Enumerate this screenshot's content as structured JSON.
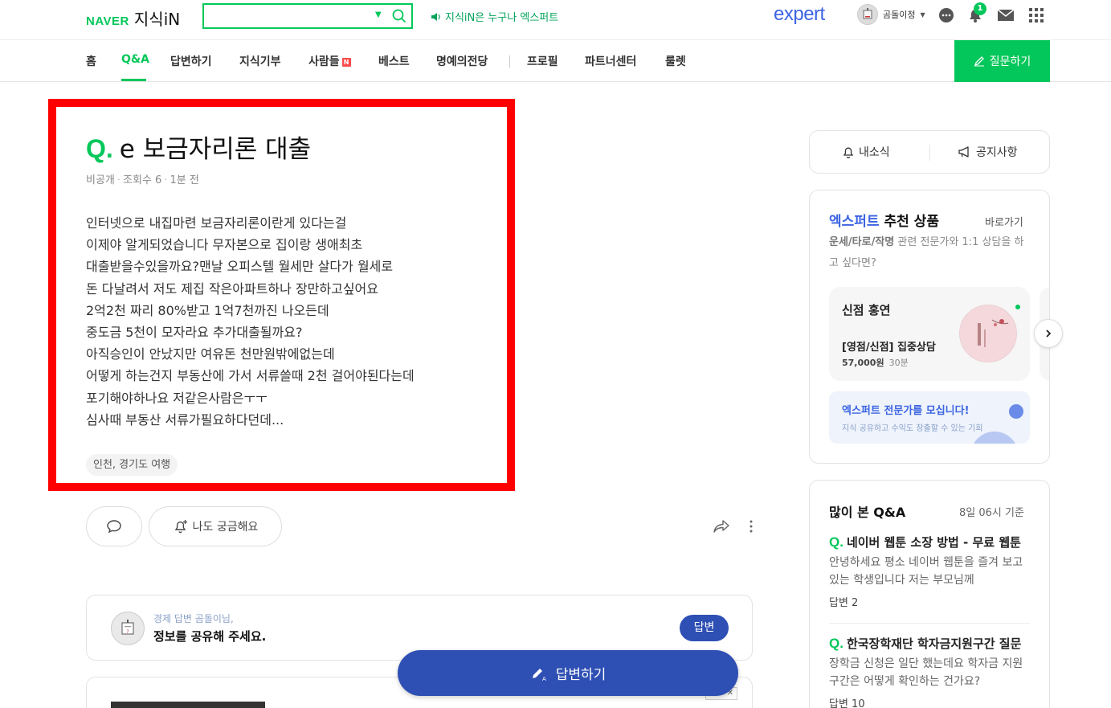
{
  "header": {
    "brand": "NAVER",
    "service": "지식iN",
    "search_placeholder": "",
    "notice": "지식iN은 누구나 엑스퍼트",
    "expert_logo": "expert",
    "user_name": "곰돌이정",
    "notification_count": "1"
  },
  "nav": {
    "items": [
      "홈",
      "Q&A",
      "답변하기",
      "지식기부",
      "사람들",
      "베스트",
      "명예의전당",
      "프로필",
      "파트너센터",
      "룰렛"
    ],
    "n_badge": "N",
    "ask_button": "질문하기"
  },
  "question": {
    "q_mark": "Q.",
    "title": "e 보금자리론 대출",
    "meta_author": "비공개",
    "meta_views": "조회수 6",
    "meta_time": "1분 전",
    "body_lines": [
      "인터넷으로 내집마련 보금자리론이란게 있다는걸",
      "이제야 알게되었습니다 무자본으로 집이랑 생애최초",
      "대출받을수있을까요?맨날 오피스텔 월세만 살다가 월세로",
      "돈 다날려서 저도 제집 작은아파트하나 장만하고싶어요",
      "2억2천 짜리 80%받고 1억7천까진 나오든데",
      "중도금 5천이 모자라요 추가대출될까요?",
      "아직승인이 안났지만 여유돈 천만원밖에없는데",
      "어떻게 하는건지 부동산에 가서 서류쓸때 2천 걸어야된다는데",
      "포기해야하나요 저같은사람은ㅜㅜ",
      "심사때 부동산 서류가필요하다던데..."
    ],
    "tag": "인천, 경기도 여행",
    "curious_button": "나도 궁금해요"
  },
  "answer_prompt": {
    "sub": "경제 답변 곰돌이님,",
    "main": "정보를 공유해 주세요.",
    "button": "답변"
  },
  "floating_answer": "답변하기",
  "sidebar": {
    "notify": "내소식",
    "announce": "공지사항",
    "expert": {
      "title_blue": "엑스퍼트",
      "title_rest": " 추천 상품",
      "link": "바로가기",
      "desc_bold": "운세/타로/작명",
      "desc_rest": " 관련 전문가와 1:1 상담을 하고 싶다면?",
      "product_name": "신점 홍연",
      "product_desc": "[영점/신점] 집중상담",
      "product_price": "57,000원",
      "product_duration": "30분",
      "recruit_main": "엑스퍼트 전문가를 모십니다!",
      "recruit_sub": "지식 공유하고 수익도 창출할 수 있는 기회"
    },
    "popular": {
      "title": "많이 본 Q&A",
      "time": "8일 06시 기준",
      "q_mark": "Q.",
      "items": [
        {
          "title": "네이버 웹툰 소장 방법 - 무료 웹툰",
          "body": "안녕하세요 평소 네이버 웹툰을 즐겨 보고 있는 학생입니다 저는 부모님께",
          "count": "답변 2"
        },
        {
          "title": "한국장학재단 학자금지원구간 질문",
          "body": "장학금 신청은 일단 했는데요 학자금 지원구간은 어떻게 확인하는 건가요?",
          "count": "답변 10"
        }
      ]
    }
  },
  "colors": {
    "naver_green": "#03c75a",
    "expert_blue": "#3c64e3",
    "answer_blue": "#2e4fb3",
    "highlight_red": "#ff0000"
  }
}
